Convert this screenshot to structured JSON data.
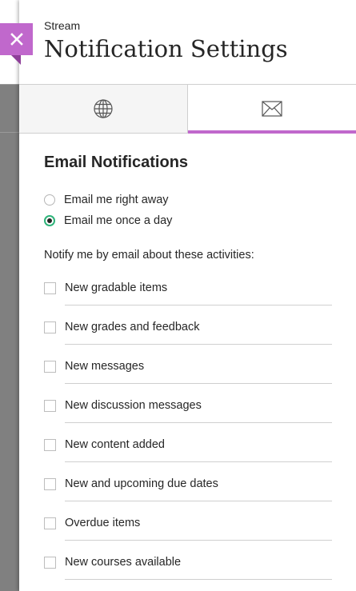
{
  "header": {
    "kicker": "Stream",
    "title": "Notification Settings"
  },
  "close_button": {
    "icon": "close-icon",
    "color": "#c068cc"
  },
  "tabs": [
    {
      "name": "globe",
      "icon": "globe-icon",
      "selected": false
    },
    {
      "name": "email",
      "icon": "envelope-icon",
      "selected": true
    }
  ],
  "colors": {
    "accent": "#c068cc",
    "radio_selected": "#2fb37a"
  },
  "email": {
    "section_title": "Email Notifications",
    "frequency_options": [
      {
        "label": "Email me right away",
        "selected": false
      },
      {
        "label": "Email me once a day",
        "selected": true
      }
    ],
    "activities_label": "Notify me by email about these activities:",
    "activities": [
      {
        "label": "New gradable items",
        "checked": false
      },
      {
        "label": "New grades and feedback",
        "checked": false
      },
      {
        "label": "New messages",
        "checked": false
      },
      {
        "label": "New discussion messages",
        "checked": false
      },
      {
        "label": "New content added",
        "checked": false
      },
      {
        "label": "New and upcoming due dates",
        "checked": false
      },
      {
        "label": "Overdue items",
        "checked": false
      },
      {
        "label": "New courses available",
        "checked": false
      }
    ]
  }
}
